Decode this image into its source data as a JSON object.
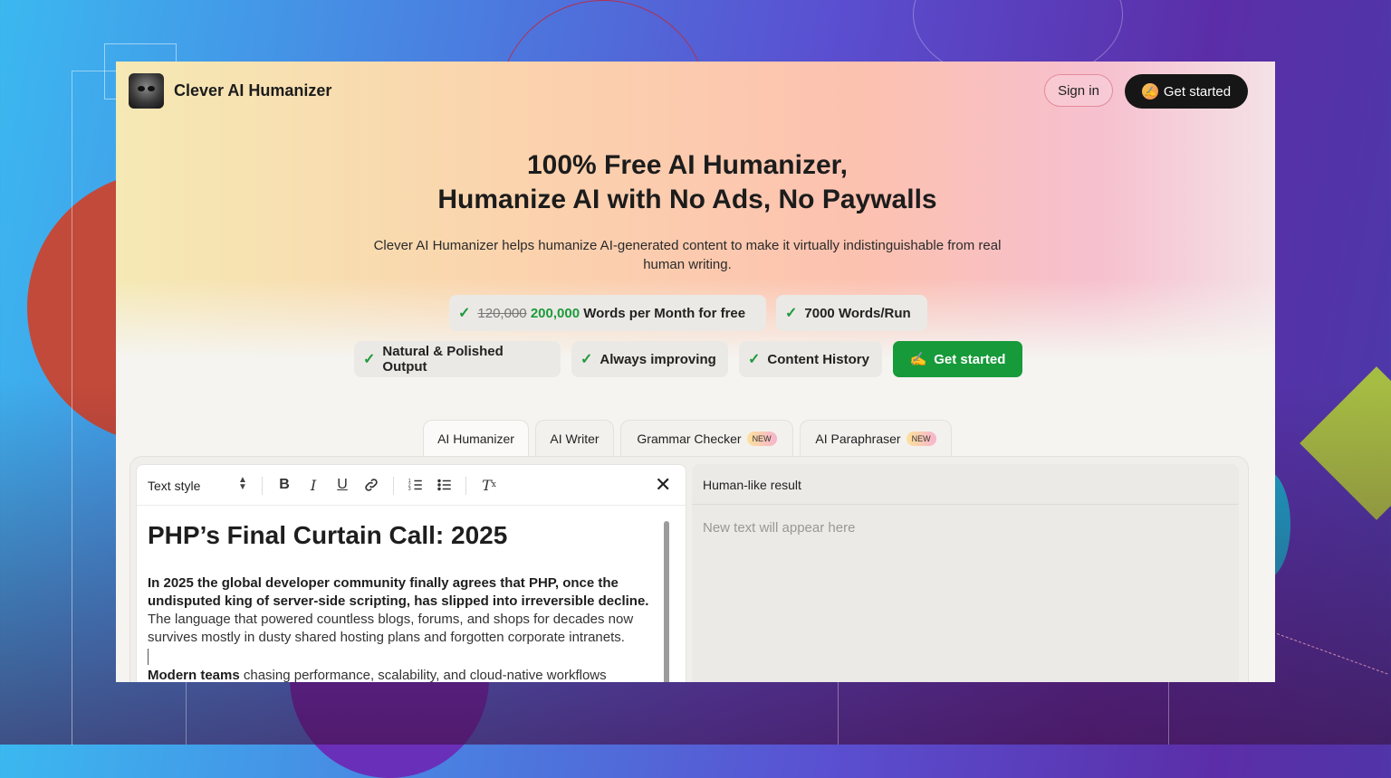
{
  "header": {
    "brand": "Clever AI Humanizer",
    "sign_in": "Sign in",
    "get_started": "Get started"
  },
  "hero": {
    "title_line1": "100% Free AI Humanizer,",
    "title_line2": "Humanize AI with No Ads, No Paywalls",
    "subtitle": "Clever AI Humanizer helps humanize AI-generated content to make it virtually indistinguishable from real human writing."
  },
  "features": {
    "old_words": "120,000",
    "new_words": "200,000",
    "words_suffix": "Words per Month for free",
    "per_run": "7000 Words/Run",
    "natural": "Natural & Polished Output",
    "improving": "Always improving",
    "history": "Content History",
    "cta": "Get started",
    "cta_emoji": "✍️"
  },
  "tabs": [
    {
      "label": "AI Humanizer",
      "badge": ""
    },
    {
      "label": "AI Writer",
      "badge": ""
    },
    {
      "label": "Grammar Checker",
      "badge": "NEW"
    },
    {
      "label": "AI Paraphraser",
      "badge": "NEW"
    }
  ],
  "editor": {
    "text_style": "Text style",
    "doc_title": "PHP’s Final Curtain Call: 2025",
    "para1_bold": "In 2025 the global developer community finally agrees that PHP, once the undisputed king of server-side scripting, has slipped into irreversible decline.",
    "para1_rest": " The language that powered countless blogs, forums, and shops for decades now survives mostly in dusty shared hosting plans and forgotten corporate intranets.",
    "para2_bold": "Modern teams",
    "para2_rest": " chasing performance, scalability, and cloud-native workflows"
  },
  "result": {
    "title": "Human-like result",
    "placeholder": "New text will appear here"
  },
  "icons": [
    "bold-icon",
    "italic-icon",
    "underline-icon",
    "link-icon",
    "ordered-list-icon",
    "bullet-list-icon",
    "clear-format-icon",
    "close-icon",
    "check-icon"
  ],
  "colors": {
    "accent_green": "#179a3a",
    "dark_button": "#161616"
  }
}
